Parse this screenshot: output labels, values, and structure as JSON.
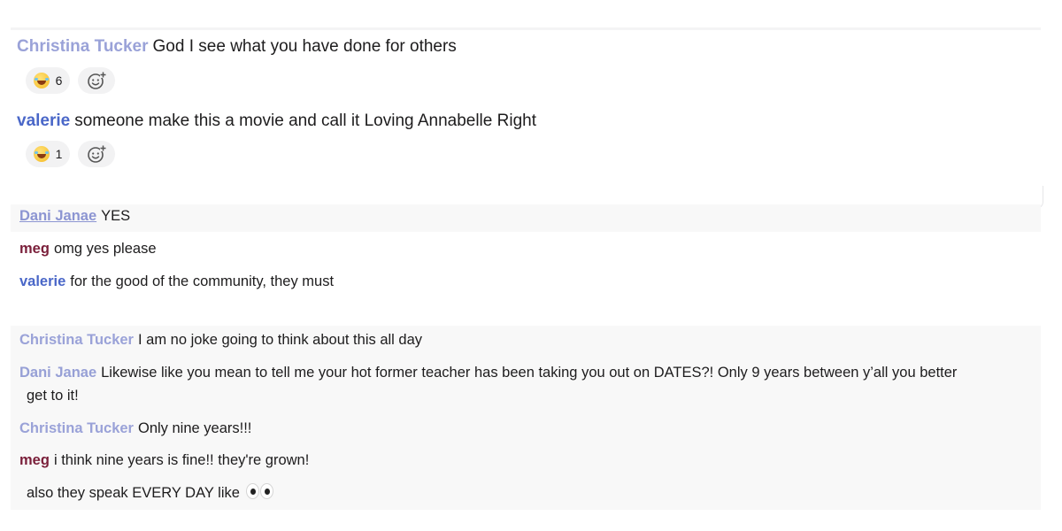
{
  "messages": [
    {
      "author": "Christina Tucker",
      "text": "God I see what you have done for others",
      "reactions": [
        {
          "emoji": "face-with-tears-of-joy",
          "count": "6"
        }
      ]
    },
    {
      "author": "valerie",
      "text": "someone make this a movie and call it Loving Annabelle Right",
      "reactions": [
        {
          "emoji": "face-with-tears-of-joy",
          "count": "1"
        }
      ]
    },
    {
      "author": "Dani Janae",
      "text": "YES"
    },
    {
      "author": "meg",
      "text": "omg yes please"
    },
    {
      "author": "valerie",
      "text": "for the good of the community, they must"
    },
    {
      "author": "Christina Tucker",
      "text": "I am no joke going to think about this all day"
    },
    {
      "author": "Dani Janae",
      "text": "Likewise like you mean to tell me your hot former teacher has been taking you out on DATES?! Only 9 years between y’all you better",
      "text_continued": "get to it!"
    },
    {
      "author": "Christina Tucker",
      "text": "Only nine years!!!"
    },
    {
      "author": "meg",
      "text": "i think nine years is fine!! they're grown!"
    },
    {
      "author": "",
      "text": "also they speak EVERY DAY like",
      "trailing_emoji": "eyes"
    }
  ],
  "icons": {
    "add_reaction": "add-reaction-icon",
    "reaction": "face-with-tears-of-joy-icon",
    "eyes": "eyes-icon"
  },
  "colors": {
    "christina": "#9aa2d8",
    "valerie": "#4a67c8",
    "meg": "#7a1f3a",
    "dani": "#8c95d2",
    "pill": "#f2f2f3",
    "band": "#f8f8f8"
  }
}
